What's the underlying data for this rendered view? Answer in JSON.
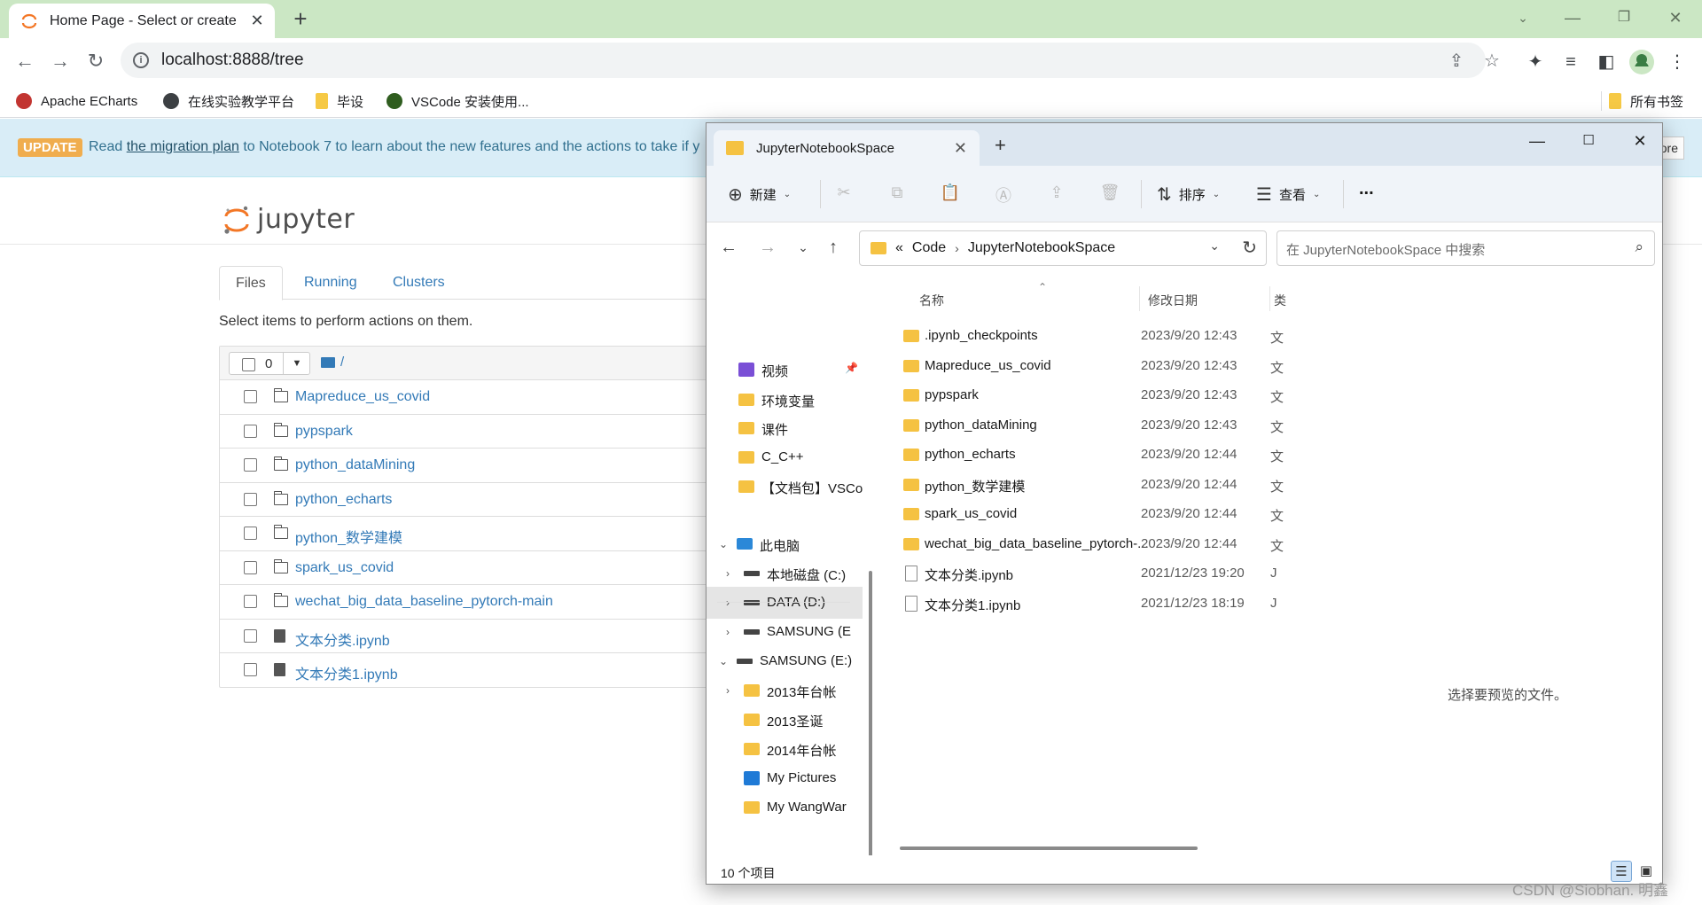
{
  "browser": {
    "tab_title": "Home Page - Select or create",
    "url": "localhost:8888/tree",
    "bookmarks": [
      {
        "label": "Apache ECharts",
        "icon": "echarts-icon"
      },
      {
        "label": "在线实验教学平台",
        "icon": "globe-icon"
      },
      {
        "label": "毕设",
        "icon": "folder-icon"
      },
      {
        "label": "VSCode 安装使用...",
        "icon": "vscode-icon"
      }
    ],
    "all_bookmarks": "所有书签"
  },
  "jupyter": {
    "update_badge": "UPDATE",
    "update_pre": "Read ",
    "update_link": "the migration plan",
    "update_post": " to Notebook 7 to learn about the new features and the actions to take if y",
    "update_button": "ore",
    "logo": "jupyter",
    "tabs": [
      "Files",
      "Running",
      "Clusters"
    ],
    "hint": "Select items to perform actions on them.",
    "selected_count": "0",
    "breadcrumb": "/",
    "items": [
      {
        "name": "Mapreduce_us_covid",
        "type": "dir"
      },
      {
        "name": "pypspark",
        "type": "dir"
      },
      {
        "name": "python_dataMining",
        "type": "dir"
      },
      {
        "name": "python_echarts",
        "type": "dir"
      },
      {
        "name": "python_数学建模",
        "type": "dir"
      },
      {
        "name": "spark_us_covid",
        "type": "dir"
      },
      {
        "name": "wechat_big_data_baseline_pytorch-main",
        "type": "dir"
      },
      {
        "name": "文本分类.ipynb",
        "type": "notebook"
      },
      {
        "name": "文本分类1.ipynb",
        "type": "notebook"
      }
    ]
  },
  "explorer": {
    "tab_title": "JupyterNotebookSpace",
    "toolbar": {
      "new": "新建",
      "sort": "排序",
      "view": "查看",
      "more": "..."
    },
    "path": [
      "Code",
      "JupyterNotebookSpace"
    ],
    "path_prefix": "«",
    "search_placeholder": "在 JupyterNotebookSpace 中搜索",
    "nav": [
      {
        "label": "视频",
        "icon": "video",
        "level": 0,
        "pinned": true
      },
      {
        "label": "环境变量",
        "icon": "folder",
        "level": 0
      },
      {
        "label": "课件",
        "icon": "folder",
        "level": 0
      },
      {
        "label": "C_C++",
        "icon": "folder",
        "level": 0
      },
      {
        "label": "【文档包】VSCo",
        "icon": "folder",
        "level": 0
      },
      {
        "label": "此电脑",
        "icon": "pc",
        "level": 0,
        "expanded": true
      },
      {
        "label": "本地磁盘 (C:)",
        "icon": "drive",
        "level": 1
      },
      {
        "label": "DATA (D:)",
        "icon": "drive",
        "level": 1,
        "selected": true
      },
      {
        "label": "SAMSUNG (E",
        "icon": "drive",
        "level": 1
      },
      {
        "label": "SAMSUNG (E:)",
        "icon": "drive",
        "level": 0,
        "expanded": true
      },
      {
        "label": "2013年台帐",
        "icon": "folder",
        "level": 1,
        "collapsible": true
      },
      {
        "label": "2013圣诞",
        "icon": "folder",
        "level": 1
      },
      {
        "label": "2014年台帐",
        "icon": "folder",
        "level": 1
      },
      {
        "label": "My Pictures",
        "icon": "pic",
        "level": 1
      },
      {
        "label": "My WangWar",
        "icon": "folder",
        "level": 1
      }
    ],
    "columns": {
      "name": "名称",
      "date": "修改日期",
      "type": "类"
    },
    "files": [
      {
        "name": ".ipynb_checkpoints",
        "date": "2023/9/20 12:43",
        "type": "文",
        "kind": "folder"
      },
      {
        "name": "Mapreduce_us_covid",
        "date": "2023/9/20 12:43",
        "type": "文",
        "kind": "folder"
      },
      {
        "name": "pypspark",
        "date": "2023/9/20 12:43",
        "type": "文",
        "kind": "folder"
      },
      {
        "name": "python_dataMining",
        "date": "2023/9/20 12:43",
        "type": "文",
        "kind": "folder"
      },
      {
        "name": "python_echarts",
        "date": "2023/9/20 12:44",
        "type": "文",
        "kind": "folder"
      },
      {
        "name": "python_数学建模",
        "date": "2023/9/20 12:44",
        "type": "文",
        "kind": "folder"
      },
      {
        "name": "spark_us_covid",
        "date": "2023/9/20 12:44",
        "type": "文",
        "kind": "folder"
      },
      {
        "name": "wechat_big_data_baseline_pytorch-...",
        "date": "2023/9/20 12:44",
        "type": "文",
        "kind": "folder"
      },
      {
        "name": "文本分类.ipynb",
        "date": "2021/12/23 19:20",
        "type": "J",
        "kind": "file"
      },
      {
        "name": "文本分类1.ipynb",
        "date": "2021/12/23 18:19",
        "type": "J",
        "kind": "file"
      }
    ],
    "preview_text": "选择要预览的文件。",
    "status_count": "10 个项目"
  },
  "watermark": "CSDN @Siobhan. 明鑫"
}
